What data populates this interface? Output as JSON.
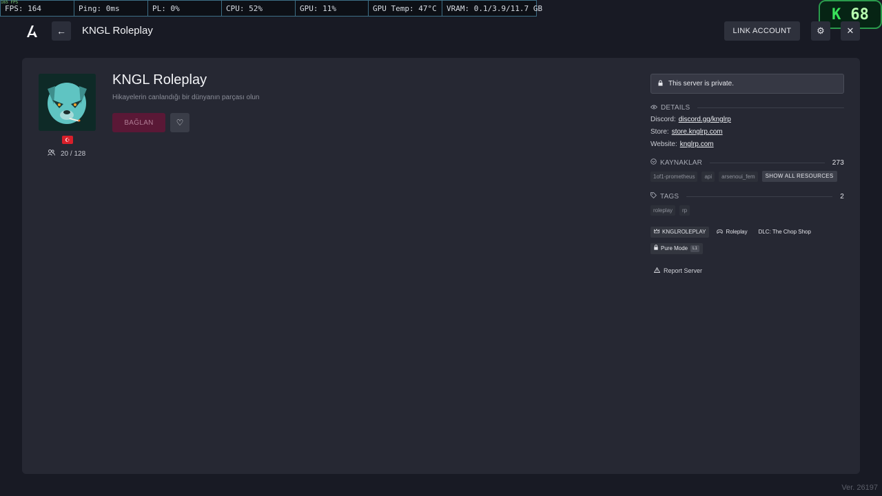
{
  "overlay": {
    "tiny_fps": "165 FPS",
    "metrics": [
      "FPS: 164",
      "Ping: 0ms",
      "PL: 0%",
      "CPU: 52%",
      "GPU: 11%",
      "GPU Temp: 47°C",
      "VRAM: 0.1/3.9/11.7 GB"
    ],
    "badge_letter": "K",
    "badge_value": "68"
  },
  "header": {
    "title": "KNGL Roleplay",
    "back_symbol": "←",
    "link_account_label": "LINK ACCOUNT",
    "settings_symbol": "⚙",
    "close_symbol": "✕"
  },
  "server": {
    "name": "KNGL Roleplay",
    "description": "Hikayelerin canlandığı bir dünyanın parçası olun",
    "connect_label": "BAĞLAN",
    "favorite_symbol": "♡",
    "flag_symbol": "☪",
    "players": "20 / 128"
  },
  "sidebar": {
    "private_notice": "This server is private.",
    "details": {
      "heading": "DETAILS",
      "discord_label": "Discord:",
      "discord_value": "discord.gg/knglrp",
      "store_label": "Store:",
      "store_value": "store.knglrp.com",
      "website_label": "Website:",
      "website_value": "knglrp.com"
    },
    "resources": {
      "heading": "KAYNAKLAR",
      "count": "273",
      "items": [
        "1of1-prometheus",
        "api",
        "arsenoui_fem"
      ],
      "show_all_label": "SHOW ALL RESOURCES"
    },
    "tags": {
      "heading": "TAGS",
      "count": "2",
      "items": [
        "roleplay",
        "rp"
      ]
    },
    "badges": {
      "owner": "KNGLROLEPLAY",
      "gamemode": "Roleplay",
      "dlc": "DLC: The Chop Shop",
      "pure_mode": "Pure Mode",
      "pure_level": "L1"
    },
    "report_label": "Report Server"
  },
  "footer": {
    "version": "Ver. 26197"
  },
  "colors": {
    "background": "#181a24",
    "panel": "#262833",
    "connect_button": "#5a1836",
    "flag": "#d81f2a",
    "overlay_border": "#3e6f86"
  }
}
